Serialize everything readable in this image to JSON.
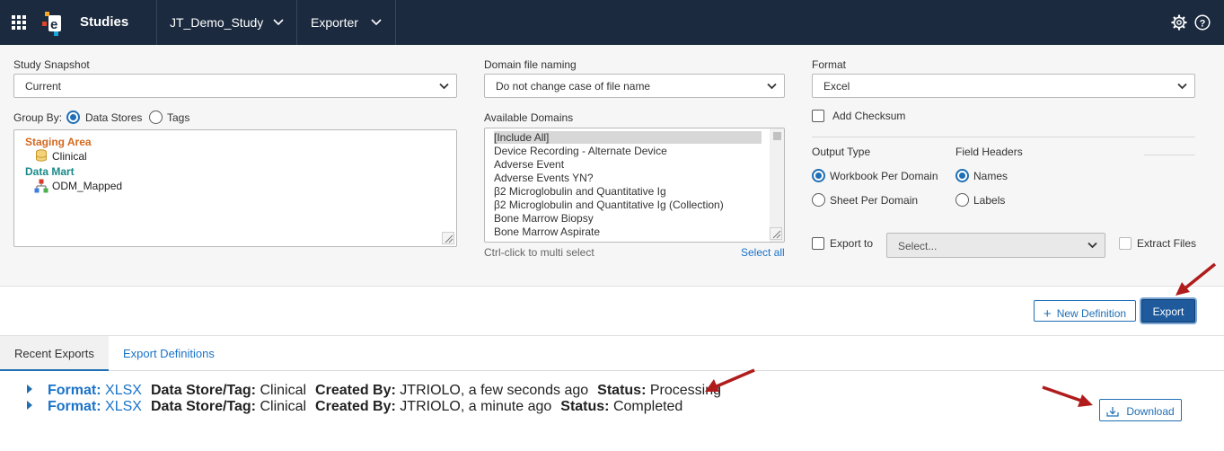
{
  "header": {
    "app_name": "Studies",
    "study": "JT_Demo_Study",
    "module": "Exporter"
  },
  "form": {
    "snapshot": {
      "label": "Study Snapshot",
      "value": "Current"
    },
    "group_by": {
      "label": "Group By:",
      "options": [
        "Data Stores",
        "Tags"
      ],
      "selected": "Data Stores"
    },
    "tree": {
      "groups": [
        {
          "label": "Staging Area",
          "color": "#d2691e",
          "items": [
            "Clinical"
          ]
        },
        {
          "label": "Data Mart",
          "color": "#1a8a8a",
          "items": [
            "ODM_Mapped"
          ]
        }
      ]
    },
    "domain_naming": {
      "label": "Domain file naming",
      "value": "Do not change case of file name"
    },
    "domains": {
      "label": "Available Domains",
      "items": [
        "[Include All]",
        "Device Recording - Alternate Device",
        "Adverse Event",
        "Adverse Events YN?",
        "β2 Microglobulin and Quantitative Ig",
        "β2 Microglobulin and Quantitative Ig (Collection)",
        "Bone Marrow Biopsy",
        "Bone Marrow Aspirate"
      ],
      "selected_index": 0,
      "hint": "Ctrl-click to multi select",
      "select_all": "Select all"
    },
    "format": {
      "label": "Format",
      "value": "Excel"
    },
    "add_checksum": {
      "label": "Add Checksum",
      "checked": false
    },
    "output_type": {
      "label": "Output Type",
      "options": [
        "Workbook Per Domain",
        "Sheet Per Domain"
      ],
      "selected": "Workbook Per Domain"
    },
    "field_headers": {
      "label": "Field Headers",
      "options": [
        "Names",
        "Labels"
      ],
      "selected": "Names"
    },
    "export_to": {
      "label": "Export to",
      "placeholder": "Select...",
      "checked": false
    },
    "extract_files": {
      "label": "Extract Files",
      "checked": false,
      "disabled": true
    }
  },
  "actions": {
    "new_definition": "New Definition",
    "export": "Export"
  },
  "tabs": [
    {
      "label": "Recent Exports",
      "active": true
    },
    {
      "label": "Export Definitions",
      "active": false
    }
  ],
  "exports": [
    {
      "format_label": "Format:",
      "format": "XLSX",
      "store_label": "Data Store/Tag:",
      "store": "Clinical",
      "created_label": "Created By:",
      "created": "JTRIOLO, a few seconds ago",
      "status_label": "Status:",
      "status": "Processing"
    },
    {
      "format_label": "Format:",
      "format": "XLSX",
      "store_label": "Data Store/Tag:",
      "store": "Clinical",
      "created_label": "Created By:",
      "created": "JTRIOLO, a minute ago",
      "status_label": "Status:",
      "status": "Completed"
    }
  ],
  "download_label": "Download",
  "colors": {
    "header_bg": "#1b2a3e",
    "accent": "#1f6fb5",
    "annotation_arrow": "#b01c1c"
  }
}
